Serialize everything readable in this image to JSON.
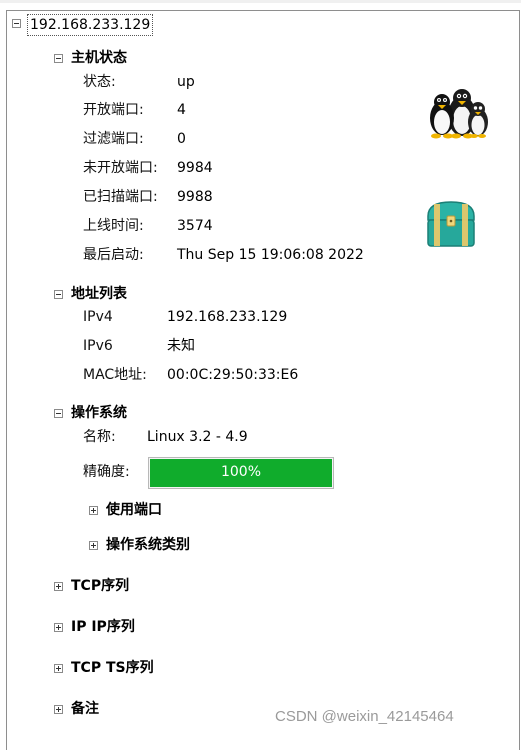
{
  "host": {
    "label": "192.168.233.129"
  },
  "host_status": {
    "title": "主机状态",
    "rows": [
      {
        "label": "状态:",
        "value": "up"
      },
      {
        "label": "开放端口:",
        "value": "4"
      },
      {
        "label": "过滤端口:",
        "value": "0"
      },
      {
        "label": "未开放端口:",
        "value": "9984"
      },
      {
        "label": "已扫描端口:",
        "value": "9988"
      },
      {
        "label": "上线时间:",
        "value": "3574"
      },
      {
        "label": "最后启动:",
        "value": "Thu Sep 15 19:06:08 2022"
      }
    ],
    "icons": [
      "linux-penguins-icon",
      "treasure-chest-icon"
    ]
  },
  "addresses": {
    "title": "地址列表",
    "rows": [
      {
        "label": "IPv4",
        "value": "192.168.233.129"
      },
      {
        "label": "IPv6",
        "value": "未知"
      },
      {
        "label": "MAC地址:",
        "value": "00:0C:29:50:33:E6"
      }
    ]
  },
  "os": {
    "title": "操作系统",
    "name_label": "名称:",
    "name_value": "Linux 3.2 - 4.9",
    "accuracy_label": "精确度:",
    "accuracy_value": 1.0,
    "accuracy_text": "100%",
    "accuracy_color": "#10ac2c",
    "subnodes": [
      "使用端口",
      "操作系统类别"
    ]
  },
  "collapsed_sections": [
    "TCP序列",
    "IP IP序列",
    "TCP TS序列",
    "备注"
  ],
  "watermark": "CSDN @weixin_42145464"
}
